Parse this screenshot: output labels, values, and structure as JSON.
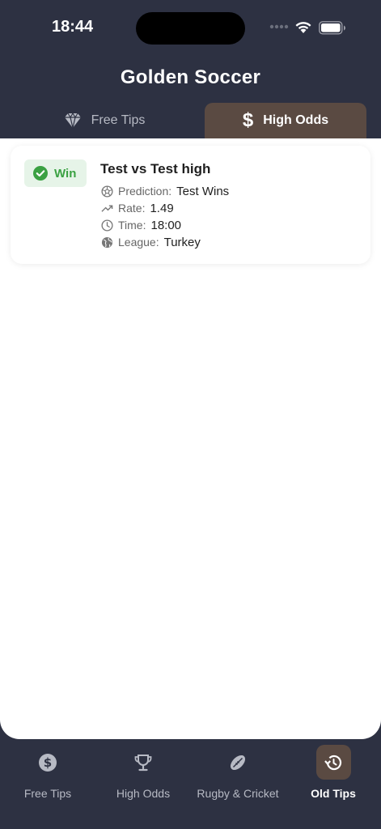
{
  "status_bar": {
    "time": "18:44"
  },
  "app": {
    "title": "Golden Soccer"
  },
  "tabs": [
    {
      "label": "Free Tips",
      "icon": "diamond-icon",
      "active": false
    },
    {
      "label": "High Odds",
      "icon": "dollar-icon",
      "active": true
    }
  ],
  "card": {
    "badge": "Win",
    "title": "Test vs Test high",
    "details": [
      {
        "label": "Prediction:",
        "value": "Test Wins",
        "icon": "soccer-ball-icon"
      },
      {
        "label": "Rate:",
        "value": "1.49",
        "icon": "trending-up-icon"
      },
      {
        "label": "Time:",
        "value": "18:00",
        "icon": "clock-icon"
      },
      {
        "label": "League:",
        "value": "Turkey",
        "icon": "globe-icon"
      }
    ]
  },
  "bottom_nav": [
    {
      "label": "Free Tips",
      "icon": "dollar-circle-icon",
      "active": false
    },
    {
      "label": "High Odds",
      "icon": "trophy-icon",
      "active": false
    },
    {
      "label": "Rugby & Cricket",
      "icon": "rugby-ball-icon",
      "active": false
    },
    {
      "label": "Old Tips",
      "icon": "history-icon",
      "active": true
    }
  ],
  "colors": {
    "header_bg": "#2d3142",
    "active_tab_bg": "#5a4a42",
    "win_green": "#3aa142",
    "win_bg": "#e6f4e8"
  }
}
